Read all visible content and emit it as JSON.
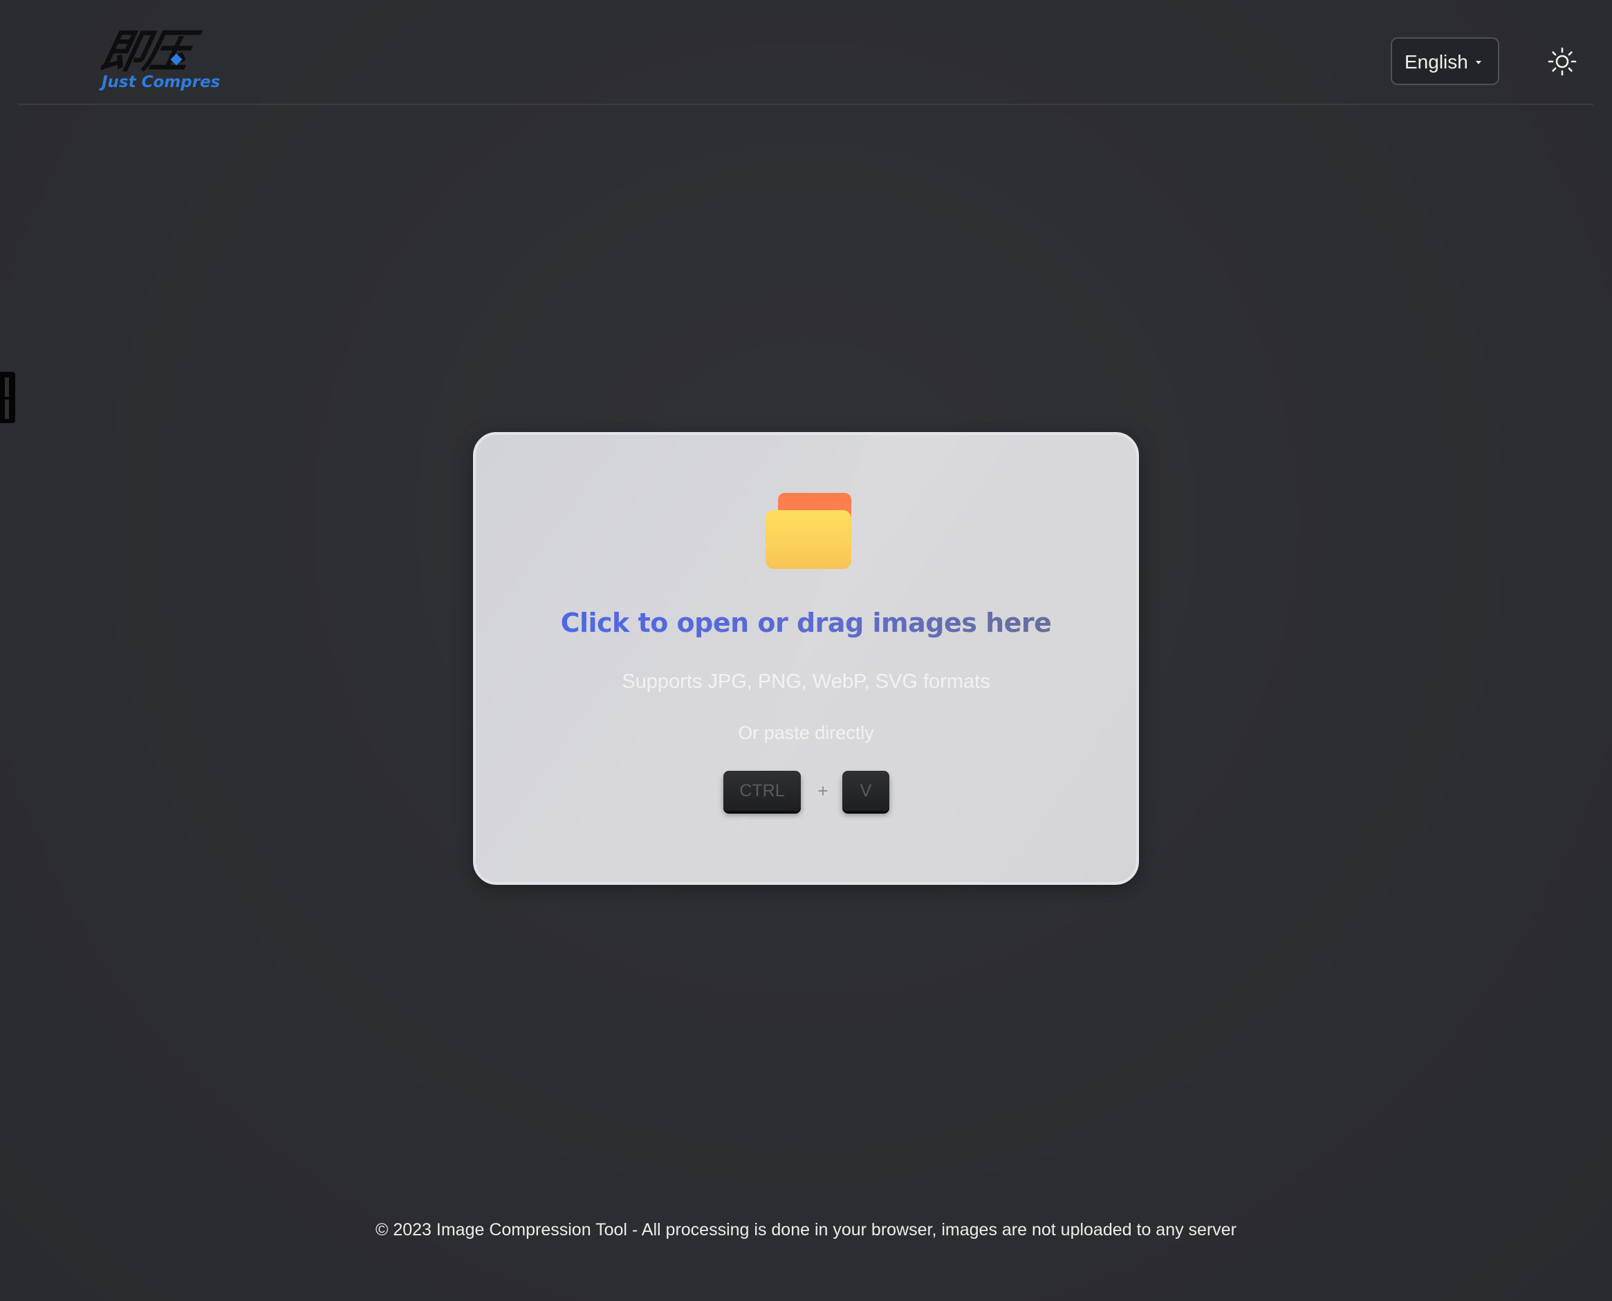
{
  "header": {
    "logo_text": "即压",
    "logo_subtitle": "Just Compres",
    "language": {
      "selected": "English"
    },
    "theme_toggle_icon": "sun-icon"
  },
  "dropzone": {
    "icon": "folder-icon",
    "title": "Click to open or drag images here",
    "formats": "Supports JPG, PNG, WebP, SVG formats",
    "paste_hint": "Or paste directly",
    "shortcut": {
      "key1": "CTRL",
      "plus": "+",
      "key2": "V"
    }
  },
  "footer": {
    "text": "© 2023 Image Compression Tool - All processing is done in your browser, images are not uploaded to any server"
  },
  "colors": {
    "background": "#2d2e31",
    "accent": "#4866ec",
    "logo_blue": "#2f7be0",
    "folder_orange": "#ff7d4a",
    "folder_yellow": "#ffde5c"
  }
}
